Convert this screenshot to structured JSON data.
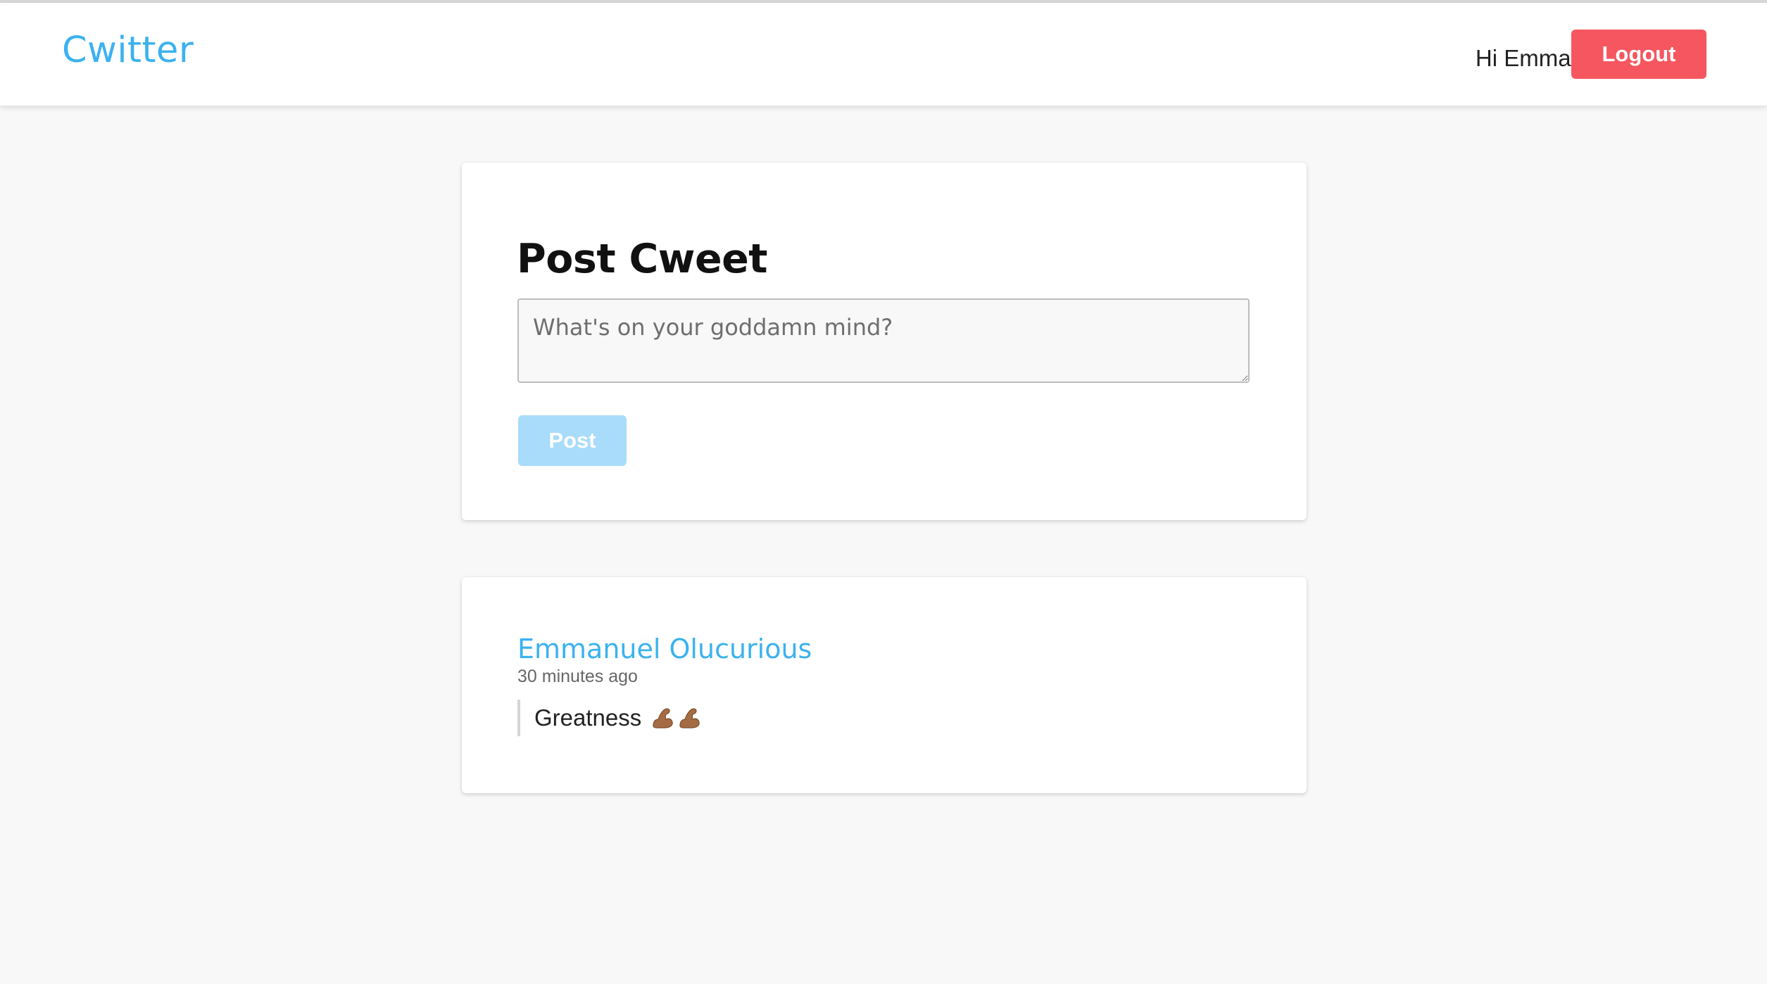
{
  "header": {
    "brand": "Cwitter",
    "greeting": "Hi Emmanuel",
    "logout_label": "Logout"
  },
  "composer": {
    "title": "Post Cweet",
    "placeholder": "What's on your goddamn mind?",
    "value": "",
    "post_label": "Post"
  },
  "cweets": [
    {
      "author": "Emmanuel Olucurious",
      "time": "30 minutes ago",
      "text": "Greatness",
      "emoji": [
        "flexed-biceps-icon",
        "flexed-biceps-icon"
      ]
    }
  ],
  "colors": {
    "brand": "#3bb2ef",
    "logout_bg": "#f5565f",
    "post_disabled_bg": "#a9dcfa",
    "page_bg": "#f8f8f8"
  }
}
